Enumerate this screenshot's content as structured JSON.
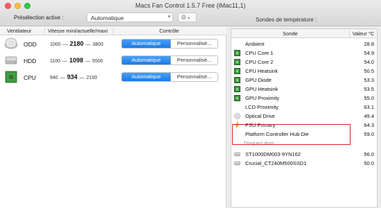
{
  "window": {
    "title": "Macs Fan Control 1.5.7 Free (iMac11,1)"
  },
  "preset": {
    "label": "Présélection active :",
    "value": "Automatique",
    "gear_icon": "gear-icon"
  },
  "sensors_label": "Sondes de température :",
  "fans": {
    "headers": {
      "fan": "Ventilateur",
      "speed": "Vitesse mini/actuelle/maxi",
      "control": "Contrôle"
    },
    "items": [
      {
        "name": "ODD",
        "icon": "optical-drive-icon",
        "min": "1000",
        "current": "2180",
        "max": "3800",
        "auto_label": "Automatique",
        "custom_label": "Personnalisé..."
      },
      {
        "name": "HDD",
        "icon": "hard-drive-icon",
        "min": "1100",
        "current": "1098",
        "max": "5500",
        "auto_label": "Automatique",
        "custom_label": "Personnalisé..."
      },
      {
        "name": "CPU",
        "icon": "cpu-chip-icon",
        "min": "940",
        "current": "934",
        "max": "2100",
        "auto_label": "Automatique",
        "custom_label": "Personnalisé..."
      }
    ],
    "selected_mode": "Automatique",
    "dash": "—"
  },
  "sensors": {
    "headers": {
      "name": "Sonde",
      "value": "Valeur °C"
    },
    "items": [
      {
        "name": "Ambient",
        "value": "28.8",
        "icon": "none"
      },
      {
        "name": "CPU Core 1",
        "value": "54.9",
        "icon": "chip-icon"
      },
      {
        "name": "CPU Core 2",
        "value": "54.0",
        "icon": "chip-icon"
      },
      {
        "name": "CPU Heatsink",
        "value": "50.5",
        "icon": "chip-icon"
      },
      {
        "name": "GPU Diode",
        "value": "53.3",
        "icon": "chip-icon"
      },
      {
        "name": "GPU Heatsink",
        "value": "53.5",
        "icon": "chip-icon"
      },
      {
        "name": "GPU Proximity",
        "value": "55.0",
        "icon": "chip-icon"
      },
      {
        "name": "LCD Proximity",
        "value": "63.1",
        "icon": "none"
      },
      {
        "name": "Optical Drive",
        "value": "49.4",
        "icon": "disc-icon"
      },
      {
        "name": "PSU Primary",
        "value": "64.3",
        "icon": "lightning-icon"
      },
      {
        "name": "Platform Controller Hub Die",
        "value": "59.0",
        "icon": "none"
      }
    ],
    "disks_group_label": "Disques durs :",
    "disks": [
      {
        "name": "ST1000DM003-9YN162",
        "value": "56.0",
        "icon": "drive-icon"
      },
      {
        "name": "Crucial_CT240M500SSD1",
        "value": "50.0",
        "icon": "drive-icon"
      }
    ],
    "highlight_color": "#d62424"
  }
}
